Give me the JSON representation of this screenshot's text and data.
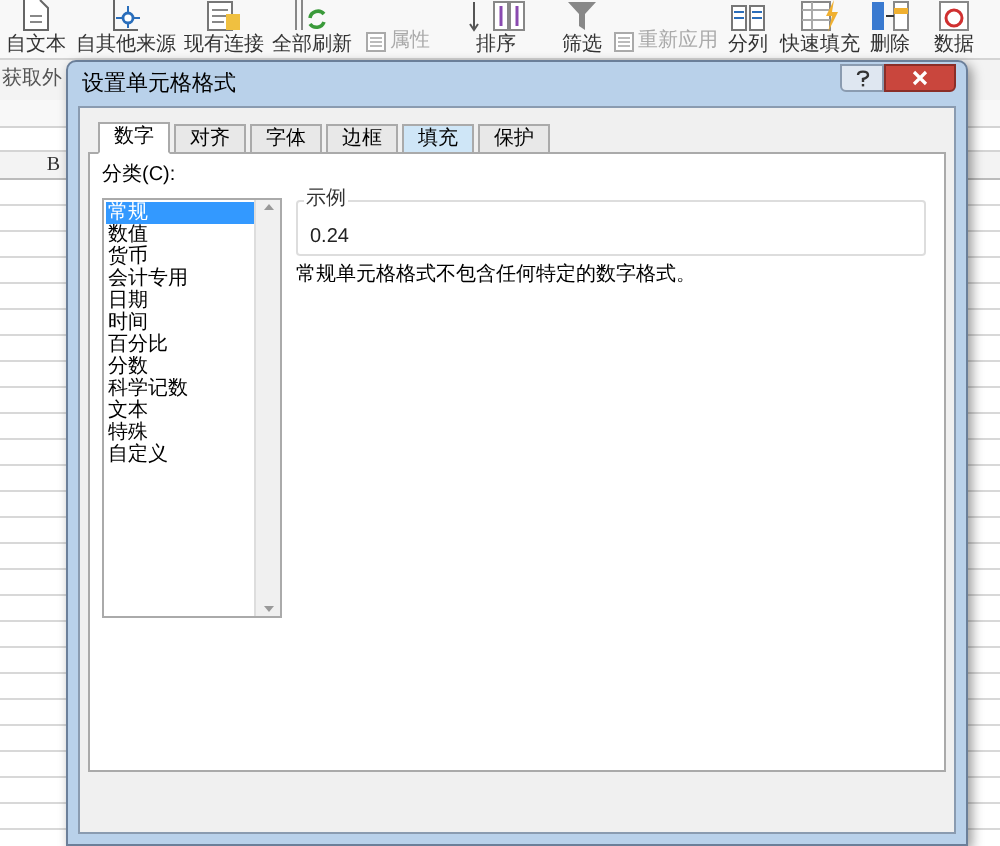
{
  "ribbon": {
    "buttons": [
      {
        "label": "自文本",
        "kind": "doc"
      },
      {
        "label": "自其他来源",
        "kind": "node"
      },
      {
        "label": "现有连接",
        "kind": "list"
      },
      {
        "label": "全部刷新",
        "kind": "refresh"
      },
      {
        "label": "属性",
        "kind": "small"
      },
      {
        "label": "排序",
        "kind": "sort"
      },
      {
        "label": "筛选",
        "kind": "filter"
      },
      {
        "label": "重新应用",
        "kind": "small"
      },
      {
        "label": "分列",
        "kind": "columns"
      },
      {
        "label": "快速填充",
        "kind": "flash"
      },
      {
        "label": "删除",
        "kind": "delete"
      },
      {
        "label": "数据",
        "kind": "data"
      }
    ],
    "group_label": "获取外"
  },
  "sheet": {
    "column_header": "B"
  },
  "dialog": {
    "title": "设置单元格格式",
    "tabs": [
      {
        "label": "数字",
        "selected": true,
        "hovered": false
      },
      {
        "label": "对齐",
        "selected": false,
        "hovered": false
      },
      {
        "label": "字体",
        "selected": false,
        "hovered": false
      },
      {
        "label": "边框",
        "selected": false,
        "hovered": false
      },
      {
        "label": "填充",
        "selected": false,
        "hovered": true
      },
      {
        "label": "保护",
        "selected": false,
        "hovered": false
      }
    ],
    "category_label": "分类(C):",
    "categories": [
      {
        "label": "常规",
        "selected": true
      },
      {
        "label": "数值",
        "selected": false
      },
      {
        "label": "货币",
        "selected": false
      },
      {
        "label": "会计专用",
        "selected": false
      },
      {
        "label": "日期",
        "selected": false
      },
      {
        "label": "时间",
        "selected": false
      },
      {
        "label": "百分比",
        "selected": false
      },
      {
        "label": "分数",
        "selected": false
      },
      {
        "label": "科学记数",
        "selected": false
      },
      {
        "label": "文本",
        "selected": false
      },
      {
        "label": "特殊",
        "selected": false
      },
      {
        "label": "自定义",
        "selected": false
      }
    ],
    "sample": {
      "label": "示例",
      "value": "0.24"
    },
    "description": "常规单元格格式不包含任何特定的数字格式。"
  }
}
